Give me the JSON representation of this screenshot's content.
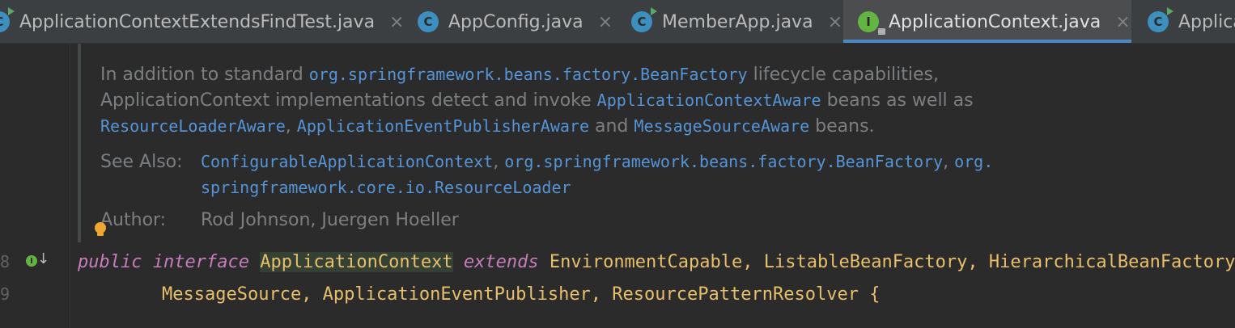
{
  "tabs": [
    {
      "label": "ApplicationContextExtendsFindTest.java",
      "icon": "class-icon",
      "closable": true,
      "active": false
    },
    {
      "label": "AppConfig.java",
      "icon": "class-icon",
      "closable": true,
      "active": false
    },
    {
      "label": "MemberApp.java",
      "icon": "runnable-class-icon",
      "closable": true,
      "active": false
    },
    {
      "label": "ApplicationContext.java",
      "icon": "interface-icon",
      "closable": true,
      "active": true
    },
    {
      "label": "Applica",
      "icon": "class-icon",
      "closable": false,
      "active": false
    }
  ],
  "icon_letters": {
    "class": "C",
    "interface": "I"
  },
  "close_glyph": "×",
  "doc": {
    "lines": [
      [
        "In addition to standard ",
        {
          "link": "org.springframework.beans.factory.BeanFactory"
        },
        " lifecycle capabilities,"
      ],
      [
        "ApplicationContext implementations detect and invoke ",
        {
          "link": "ApplicationContextAware"
        },
        " beans as well as"
      ],
      [
        {
          "link": "ResourceLoaderAware"
        },
        ", ",
        {
          "link": "ApplicationEventPublisherAware"
        },
        " and ",
        {
          "link": "MessageSourceAware"
        },
        " beans."
      ]
    ],
    "see_also_label": "See Also:",
    "see_also_lines": [
      [
        {
          "link": "ConfigurableApplicationContext"
        },
        ", ",
        {
          "link": "org.springframework.beans.factory.BeanFactory"
        },
        ", ",
        {
          "link": "org."
        }
      ],
      [
        {
          "link": "springframework.core.io.ResourceLoader"
        }
      ]
    ],
    "author_label": "Author:",
    "author_value": "Rod Johnson, Juergen Hoeller"
  },
  "code": {
    "line_numbers": [
      "8",
      "9"
    ],
    "line1": {
      "kw_public": "public",
      "kw_interface": "interface",
      "name": "ApplicationContext",
      "kw_extends": "extends",
      "rest": "EnvironmentCapable, ListableBeanFactory, HierarchicalBeanFactory,"
    },
    "line2": {
      "rest": "MessageSource, ApplicationEventPublisher, ResourcePatternResolver",
      "brace": "{"
    }
  },
  "colors": {
    "link": "#5594d6",
    "doc_text": "#7c7f82",
    "keyword": "#c77dbb",
    "interface_name": "#e8bf6a",
    "code_text": "#a9b7c6",
    "tab_underline": "#4a88c7"
  }
}
